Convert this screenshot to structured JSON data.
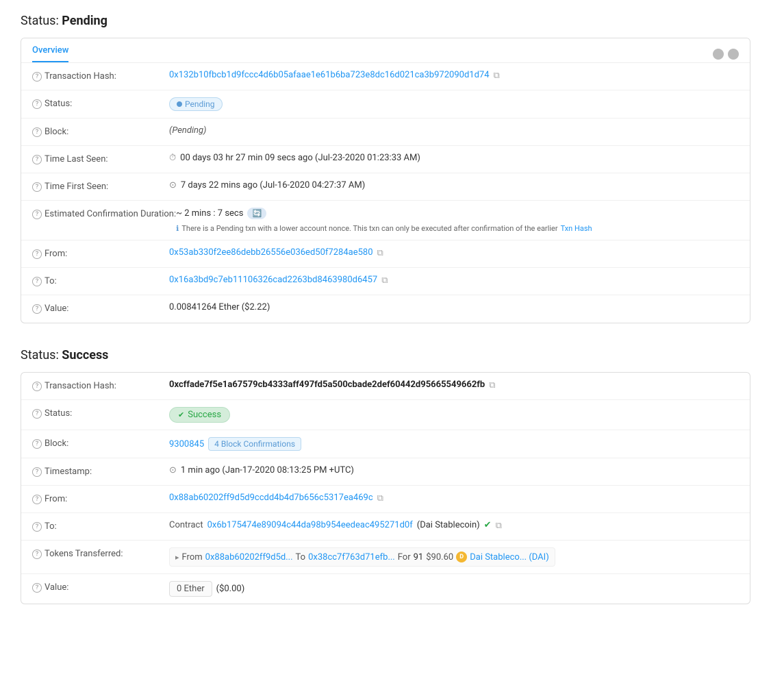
{
  "pending_section": {
    "title_prefix": "Status: ",
    "title_bold": "Pending",
    "card": {
      "tab": "Overview",
      "rows": [
        {
          "label": "Transaction Hash:",
          "value_text": "0x132b10fbcb1d9fccc4d6b05afaae1e61b6ba723e8dc16d021ca3b972090d1d74",
          "type": "hash_link"
        },
        {
          "label": "Status:",
          "value_text": "Pending",
          "type": "badge_pending"
        },
        {
          "label": "Block:",
          "value_text": "(Pending)",
          "type": "italic"
        },
        {
          "label": "Time Last Seen:",
          "value_text": "00 days 03 hr 27 min 09 secs ago (Jul-23-2020 01:23:33 AM)",
          "type": "time_last"
        },
        {
          "label": "Time First Seen:",
          "value_text": "7 days 22 mins ago (Jul-16-2020 04:27:37 AM)",
          "type": "time_first"
        },
        {
          "label": "Estimated Confirmation Duration:",
          "value_main": "~ 2 mins : 7 secs",
          "value_warn": "There is a Pending txn with a lower account nonce. This txn can only be executed after confirmation of the earlier",
          "value_warn_link": "Txn Hash",
          "type": "est_confirm"
        },
        {
          "label": "From:",
          "value_text": "0x53ab330f2ee86debb26556e036ed50f7284ae580",
          "type": "address_link"
        },
        {
          "label": "To:",
          "value_text": "0x16a3bd9c7eb11106326cad2263bd8463980d6457",
          "type": "address_link"
        },
        {
          "label": "Value:",
          "value_text": "0.00841264 Ether ($2.22)",
          "type": "plain"
        }
      ]
    }
  },
  "success_section": {
    "title_prefix": "Status: ",
    "title_bold": "Success",
    "card": {
      "rows": [
        {
          "label": "Transaction Hash:",
          "value_text": "0xcffade7f5e1a67579cb4333aff497fd5a500cbade2def60442d95665549662fb",
          "type": "hash_bold"
        },
        {
          "label": "Status:",
          "value_text": "Success",
          "type": "badge_success"
        },
        {
          "label": "Block:",
          "block_number": "9300845",
          "block_confirmations": "4 Block Confirmations",
          "type": "block"
        },
        {
          "label": "Timestamp:",
          "value_text": "1 min ago (Jan-17-2020 08:13:25 PM +UTC)",
          "type": "timestamp"
        },
        {
          "label": "From:",
          "value_text": "0x88ab60202ff9d5d9ccdd4b4d7b656c5317ea469c",
          "type": "address_link"
        },
        {
          "label": "To:",
          "contract_label": "Contract",
          "contract_address": "0x6b175474e89094c44da98b954eedeac495271d0f",
          "contract_name": "(Dai Stablecoin)",
          "type": "contract_to"
        },
        {
          "label": "Tokens Transferred:",
          "from_address": "0x88ab60202ff9d5d...",
          "to_address": "0x38cc7f763d71efb...",
          "amount": "91",
          "amount_usd": "$90.60",
          "token_name": "Dai Stableco... (DAI)",
          "type": "token_transfer"
        },
        {
          "label": "Value:",
          "value_box": "0 Ether",
          "value_usd": "($0.00)",
          "type": "value_box"
        }
      ]
    }
  },
  "icons": {
    "help": "?",
    "copy": "⧉",
    "clock": "⏱",
    "time": "⊙",
    "info": "ℹ",
    "arrow": "▸"
  }
}
